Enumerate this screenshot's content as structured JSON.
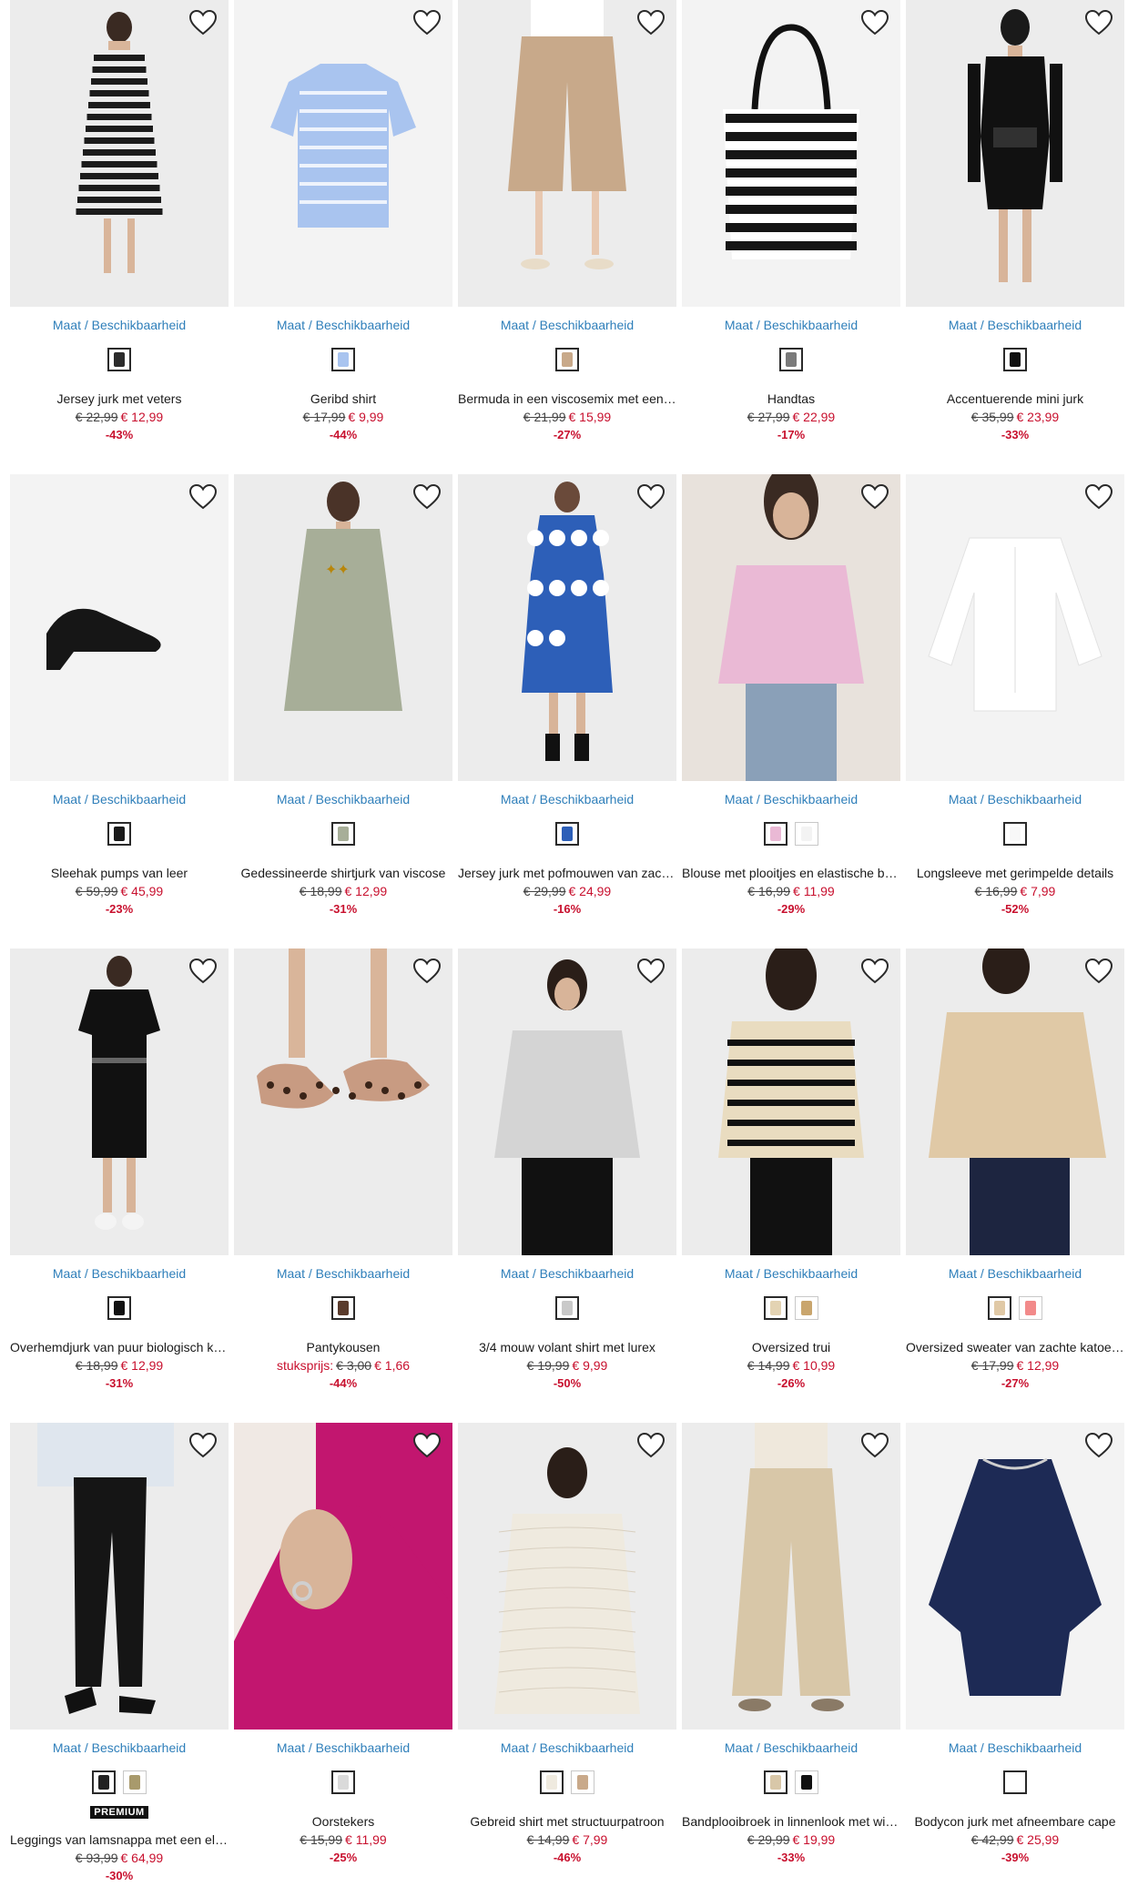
{
  "availability_label": "Maat / Beschikbaarheid",
  "premium_badge": "PREMIUM",
  "colors": {
    "link": "#2f7fba",
    "sale": "#c8102e",
    "text": "#1a1a1a"
  },
  "products": [
    {
      "name": "Jersey jurk met veters",
      "old_price": "€ 22,99",
      "price": "€ 12,99",
      "discount": "-43%",
      "swatches": [
        "#2b2b2b"
      ],
      "image": "striped-maxi-dress",
      "bg": "#ececec"
    },
    {
      "name": "Geribd shirt",
      "old_price": "€ 17,99",
      "price": "€ 9,99",
      "discount": "-44%",
      "swatches": [
        "#a9c4ef"
      ],
      "image": "blue-tie-dye-tshirt",
      "bg": "#f3f3f3"
    },
    {
      "name": "Bermuda in een viscosemix met een hoge band",
      "old_price": "€ 21,99",
      "price": "€ 15,99",
      "discount": "-27%",
      "swatches": [
        "#c8a98a"
      ],
      "image": "beige-knit-bermuda",
      "bg": "#ececec"
    },
    {
      "name": "Handtas",
      "old_price": "€ 27,99",
      "price": "€ 22,99",
      "discount": "-17%",
      "swatches": [
        "#7a7a7a"
      ],
      "image": "striped-tote-bag",
      "bg": "#f3f3f3"
    },
    {
      "name": "Accentuerende mini jurk",
      "old_price": "€ 35,99",
      "price": "€ 23,99",
      "discount": "-33%",
      "swatches": [
        "#111111"
      ],
      "image": "black-mini-dress",
      "bg": "#ececec"
    },
    {
      "name": "Sleehak pumps van leer",
      "old_price": "€ 59,99",
      "price": "€ 45,99",
      "discount": "-23%",
      "swatches": [
        "#1a1a1a"
      ],
      "image": "black-wedge-pumps",
      "bg": "#f3f3f3"
    },
    {
      "name": "Gedessineerde shirtjurk van viscose",
      "old_price": "€ 18,99",
      "price": "€ 12,99",
      "discount": "-31%",
      "swatches": [
        "#a7ae98"
      ],
      "image": "sage-shirt-dress",
      "bg": "#ececec"
    },
    {
      "name": "Jersey jurk met pofmouwen van zachte jersey",
      "old_price": "€ 29,99",
      "price": "€ 24,99",
      "discount": "-16%",
      "swatches": [
        "#2d5fb8"
      ],
      "image": "blue-pattern-dress",
      "bg": "#ececec"
    },
    {
      "name": "Blouse met plooitjes en elastische band",
      "old_price": "€ 16,99",
      "price": "€ 11,99",
      "discount": "-29%",
      "swatches": [
        "#eab9d5",
        "#f3f3f3"
      ],
      "image": "pink-blouse",
      "bg": "#e8e2dc"
    },
    {
      "name": "Longsleeve met gerimpelde details",
      "old_price": "€ 16,99",
      "price": "€ 7,99",
      "discount": "-52%",
      "swatches": [
        "#f8f8f8"
      ],
      "image": "white-longsleeve",
      "bg": "#f3f3f3"
    },
    {
      "name": "Overhemdjurk van puur biologisch katoen",
      "old_price": "€ 18,99",
      "price": "€ 12,99",
      "discount": "-31%",
      "swatches": [
        "#111111"
      ],
      "image": "black-tshirt-dress",
      "bg": "#ececec"
    },
    {
      "name": "Pantykousen",
      "unit_label": "stuksprijs:",
      "old_price": "€ 3,00",
      "price": "€ 1,66",
      "discount": "-44%",
      "swatches": [
        "#5a3b2c"
      ],
      "image": "leopard-socks",
      "bg": "#ececec"
    },
    {
      "name": "3/4 mouw volant shirt met lurex",
      "old_price": "€ 19,99",
      "price": "€ 9,99",
      "discount": "-50%",
      "swatches": [
        "#c9c9c9"
      ],
      "image": "grey-ruffle-shirt",
      "bg": "#ececec"
    },
    {
      "name": "Oversized trui",
      "old_price": "€ 14,99",
      "price": "€ 10,99",
      "discount": "-26%",
      "swatches": [
        "#e3d3b3",
        "#c9a56d"
      ],
      "image": "striped-sweater",
      "bg": "#ececec"
    },
    {
      "name": "Oversized sweater van zachte katoenmix",
      "old_price": "€ 17,99",
      "price": "€ 12,99",
      "discount": "-27%",
      "swatches": [
        "#e0c9a6",
        "#f28a8a"
      ],
      "image": "beige-sweater",
      "bg": "#ececec"
    },
    {
      "name": "Leggings van lamsnappa met een elastische band",
      "old_price": "€ 93,99",
      "price": "€ 64,99",
      "discount": "-30%",
      "swatches": [
        "#222222",
        "#a89a6c"
      ],
      "premium": true,
      "image": "leather-leggings",
      "bg": "#ececec"
    },
    {
      "name": "Oorstekers",
      "old_price": "€ 15,99",
      "price": "€ 11,99",
      "discount": "-25%",
      "swatches": [
        "#dadada"
      ],
      "image": "earrings-pink-knit",
      "bg": "#c2166f"
    },
    {
      "name": "Gebreid shirt met structuurpatroon",
      "old_price": "€ 14,99",
      "price": "€ 7,99",
      "discount": "-46%",
      "swatches": [
        "#efeadf",
        "#c9a98a"
      ],
      "image": "cream-knit-shirt",
      "bg": "#ececec"
    },
    {
      "name": "Bandplooibroek in linnenlook met wijde pijpen",
      "old_price": "€ 29,99",
      "price": "€ 19,99",
      "discount": "-33%",
      "swatches": [
        "#d8c7a8",
        "#111111"
      ],
      "image": "beige-wide-trousers",
      "bg": "#ececec"
    },
    {
      "name": "Bodycon jurk met afneembare cape",
      "old_price": "€ 42,99",
      "price": "€ 25,99",
      "discount": "-39%",
      "swatches": [
        "#ffffff"
      ],
      "image": "navy-cape-dress",
      "bg": "#f3f3f3"
    }
  ]
}
